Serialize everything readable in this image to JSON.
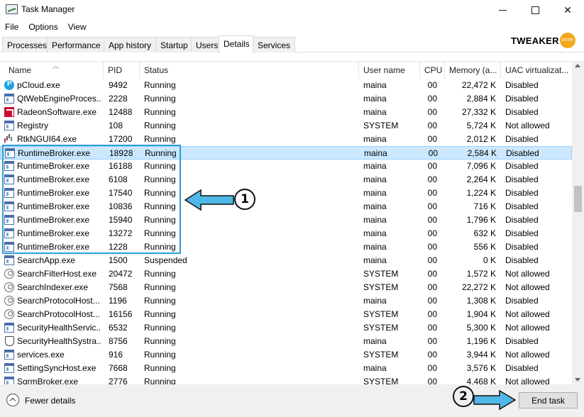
{
  "window": {
    "title": "Task Manager",
    "controls": {
      "minimize_icon": "minimize-icon",
      "maximize_icon": "maximize-icon",
      "close_icon": "close-icon",
      "close_glyph": "✕"
    }
  },
  "menu": [
    "File",
    "Options",
    "View"
  ],
  "logo": {
    "text": "TWEAKER",
    "badge": "zone"
  },
  "tabs": [
    {
      "label": "Processes",
      "active": false
    },
    {
      "label": "Performance",
      "active": false
    },
    {
      "label": "App history",
      "active": false
    },
    {
      "label": "Startup",
      "active": false
    },
    {
      "label": "Users",
      "active": false
    },
    {
      "label": "Details",
      "active": true
    },
    {
      "label": "Services",
      "active": false
    }
  ],
  "columns": [
    "Name",
    "PID",
    "Status",
    "User name",
    "CPU",
    "Memory (a...",
    "UAC virtualizat..."
  ],
  "rows": [
    {
      "icon": "pcloud-icon",
      "name": "pCloud.exe",
      "pid": "9492",
      "status": "Running",
      "user": "maina",
      "cpu": "00",
      "memory": "22,472 K",
      "uac": "Disabled"
    },
    {
      "icon": "process-icon",
      "name": "QtWebEngineProces...",
      "pid": "2228",
      "status": "Running",
      "user": "maina",
      "cpu": "00",
      "memory": "2,884 K",
      "uac": "Disabled"
    },
    {
      "icon": "radeon-icon",
      "name": "RadeonSoftware.exe",
      "pid": "12488",
      "status": "Running",
      "user": "maina",
      "cpu": "00",
      "memory": "27,332 K",
      "uac": "Disabled"
    },
    {
      "icon": "process-icon",
      "name": "Registry",
      "pid": "108",
      "status": "Running",
      "user": "SYSTEM",
      "cpu": "00",
      "memory": "5,724 K",
      "uac": "Not allowed"
    },
    {
      "icon": "audio-icon",
      "name": "RtkNGUI64.exe",
      "pid": "17200",
      "status": "Running",
      "user": "maina",
      "cpu": "00",
      "memory": "2,012 K",
      "uac": "Disabled"
    },
    {
      "icon": "process-icon",
      "name": "RuntimeBroker.exe",
      "pid": "18928",
      "status": "Running",
      "user": "maina",
      "cpu": "00",
      "memory": "2,584 K",
      "uac": "Disabled",
      "selected": true
    },
    {
      "icon": "process-icon",
      "name": "RuntimeBroker.exe",
      "pid": "16188",
      "status": "Running",
      "user": "maina",
      "cpu": "00",
      "memory": "7,096 K",
      "uac": "Disabled"
    },
    {
      "icon": "process-icon",
      "name": "RuntimeBroker.exe",
      "pid": "6108",
      "status": "Running",
      "user": "maina",
      "cpu": "00",
      "memory": "2,264 K",
      "uac": "Disabled"
    },
    {
      "icon": "process-icon",
      "name": "RuntimeBroker.exe",
      "pid": "17540",
      "status": "Running",
      "user": "maina",
      "cpu": "00",
      "memory": "1,224 K",
      "uac": "Disabled"
    },
    {
      "icon": "process-icon",
      "name": "RuntimeBroker.exe",
      "pid": "10836",
      "status": "Running",
      "user": "maina",
      "cpu": "00",
      "memory": "716 K",
      "uac": "Disabled"
    },
    {
      "icon": "process-icon",
      "name": "RuntimeBroker.exe",
      "pid": "15940",
      "status": "Running",
      "user": "maina",
      "cpu": "00",
      "memory": "1,796 K",
      "uac": "Disabled"
    },
    {
      "icon": "process-icon",
      "name": "RuntimeBroker.exe",
      "pid": "13272",
      "status": "Running",
      "user": "maina",
      "cpu": "00",
      "memory": "632 K",
      "uac": "Disabled"
    },
    {
      "icon": "process-icon",
      "name": "RuntimeBroker.exe",
      "pid": "1228",
      "status": "Running",
      "user": "maina",
      "cpu": "00",
      "memory": "556 K",
      "uac": "Disabled"
    },
    {
      "icon": "process-icon",
      "name": "SearchApp.exe",
      "pid": "1500",
      "status": "Suspended",
      "user": "maina",
      "cpu": "00",
      "memory": "0 K",
      "uac": "Disabled"
    },
    {
      "icon": "user-icon",
      "name": "SearchFilterHost.exe",
      "pid": "20472",
      "status": "Running",
      "user": "SYSTEM",
      "cpu": "00",
      "memory": "1,572 K",
      "uac": "Not allowed"
    },
    {
      "icon": "user-icon",
      "name": "SearchIndexer.exe",
      "pid": "7568",
      "status": "Running",
      "user": "SYSTEM",
      "cpu": "00",
      "memory": "22,272 K",
      "uac": "Not allowed"
    },
    {
      "icon": "user-icon",
      "name": "SearchProtocolHost...",
      "pid": "1196",
      "status": "Running",
      "user": "maina",
      "cpu": "00",
      "memory": "1,308 K",
      "uac": "Disabled"
    },
    {
      "icon": "user-icon",
      "name": "SearchProtocolHost...",
      "pid": "16156",
      "status": "Running",
      "user": "SYSTEM",
      "cpu": "00",
      "memory": "1,904 K",
      "uac": "Not allowed"
    },
    {
      "icon": "process-icon",
      "name": "SecurityHealthServic...",
      "pid": "6532",
      "status": "Running",
      "user": "SYSTEM",
      "cpu": "00",
      "memory": "5,300 K",
      "uac": "Not allowed"
    },
    {
      "icon": "shield-icon",
      "name": "SecurityHealthSystra...",
      "pid": "8756",
      "status": "Running",
      "user": "maina",
      "cpu": "00",
      "memory": "1,196 K",
      "uac": "Disabled"
    },
    {
      "icon": "process-icon",
      "name": "services.exe",
      "pid": "916",
      "status": "Running",
      "user": "SYSTEM",
      "cpu": "00",
      "memory": "3,944 K",
      "uac": "Not allowed"
    },
    {
      "icon": "process-icon",
      "name": "SettingSyncHost.exe",
      "pid": "7668",
      "status": "Running",
      "user": "maina",
      "cpu": "00",
      "memory": "3,576 K",
      "uac": "Disabled"
    },
    {
      "icon": "process-icon",
      "name": "SgrmBroker.exe",
      "pid": "2776",
      "status": "Running",
      "user": "SYSTEM",
      "cpu": "00",
      "memory": "4,468 K",
      "uac": "Not allowed"
    }
  ],
  "footer": {
    "fewer_details": "Fewer details",
    "end_task": "End task"
  },
  "annotations": {
    "badge_1": "1",
    "badge_2": "2",
    "accent_color": "#2a9fd8"
  }
}
